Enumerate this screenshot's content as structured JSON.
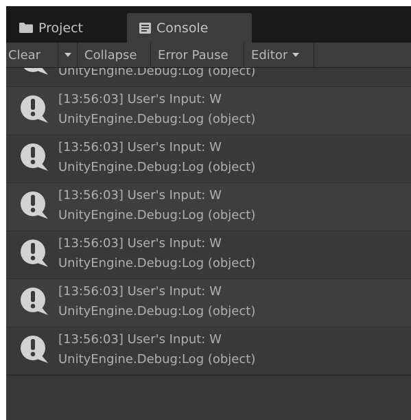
{
  "tabs": {
    "project": {
      "label": "Project",
      "icon": "folder-icon"
    },
    "console": {
      "label": "Console",
      "icon": "console-icon"
    }
  },
  "toolbar": {
    "clear_label": "Clear",
    "collapse_label": "Collapse",
    "error_pause_label": "Error Pause",
    "editor_label": "Editor"
  },
  "log": {
    "partial_entry": {
      "line2": "UnityEngine.Debug:Log (object)"
    },
    "entries": [
      {
        "line1": "[13:56:03] User's Input: W",
        "line2": "UnityEngine.Debug:Log (object)"
      },
      {
        "line1": "[13:56:03] User's Input: W",
        "line2": "UnityEngine.Debug:Log (object)"
      },
      {
        "line1": "[13:56:03] User's Input: W",
        "line2": "UnityEngine.Debug:Log (object)"
      },
      {
        "line1": "[13:56:03] User's Input: W",
        "line2": "UnityEngine.Debug:Log (object)"
      },
      {
        "line1": "[13:56:03] User's Input: W",
        "line2": "UnityEngine.Debug:Log (object)"
      },
      {
        "line1": "[13:56:03] User's Input: W",
        "line2": "UnityEngine.Debug:Log (object)"
      }
    ]
  },
  "colors": {
    "panel_bg": "#383838",
    "tabbar_bg": "#191919",
    "text": "#b0b0b0"
  }
}
